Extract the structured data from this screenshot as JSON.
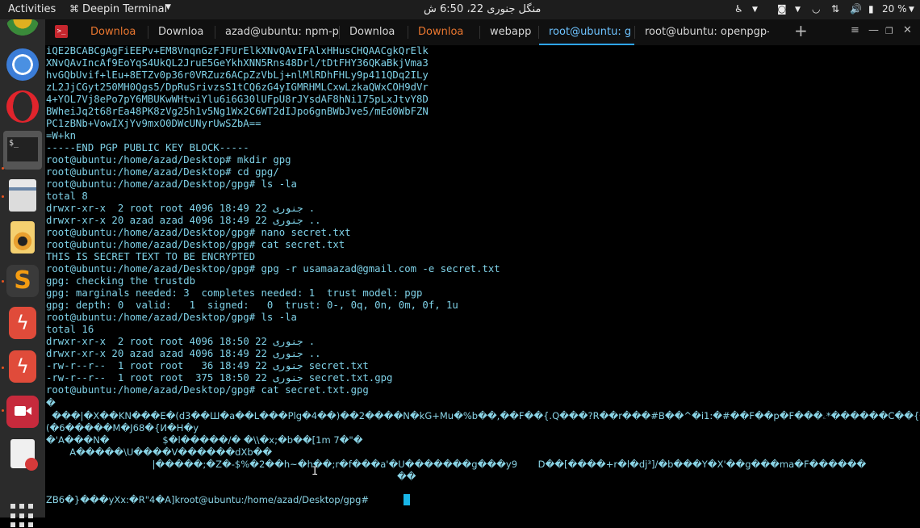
{
  "topbar": {
    "activities": "Activities",
    "app_name": "Deepin Terminal",
    "clock": "منگل جنوری 22، 6:50 ش",
    "battery": "20 %"
  },
  "dock": {
    "items": [
      "chrome-app",
      "chromium-app",
      "opera-app",
      "terminal-app",
      "files-app",
      "rhythmbox-app",
      "sublime-text-app",
      "filezilla-app",
      "filezilla-app-2",
      "screen-recorder-app",
      "text-editor-app"
    ]
  },
  "tabs": [
    {
      "label": "Downloa",
      "color": "#e9762f"
    },
    {
      "label": "Downloa",
      "color": "#d6d6d6"
    },
    {
      "label": "azad@ubuntu: npm-pro",
      "color": "#d6d6d6"
    },
    {
      "label": "Downloa",
      "color": "#d6d6d6"
    },
    {
      "label": "Downloa",
      "color": "#e9762f"
    },
    {
      "label": "webapp",
      "color": "#d6d6d6"
    },
    {
      "label": "root@ubuntu: g",
      "color": "#6ec3ff",
      "active": true
    },
    {
      "label": "root@ubuntu: openpgp-rev",
      "color": "#d6d6d6"
    }
  ],
  "terminal": {
    "lines": [
      "iQE2BCABCgAgFiEEPv+EM8VnqnGzFJFUrElkXNvQAvIFAlxHHusCHQAACgkQrElk",
      "XNvQAvIncAf9EoYqS4UkQL2JruE5GeYkhXNN5Rns48Drl/tDtFHY36QKaBkjVma3",
      "hvGQbUvif+lEu+8ETZv0p36r0VRZuz6ACpZzVbLj+nlMlRDhFHLy9p411QDq2ILy",
      "zL2JjCGyt250MH0Qgs5/DpRuSrivzsS1tCQ6zG4yIGMRHMLCxwLzkaQWxCOH9dVr",
      "4+YOL7Vj8ePo7pY6MBUKwWHtwiYlu6i6G30lUFpU8rJYsdAF8hNi175pLxJtvY8D",
      "BWheiJq2t68rEa48PK8zVg25h1v5Ng1Wx2C6WT2dIJpo6gnBWbJve5/mEd0WbFZN",
      "PC1zBNb+VowIXjYv9mxO0DWcUNyrUwSZbA==",
      "=W+kn",
      "-----END PGP PUBLIC KEY BLOCK-----",
      "root@ubuntu:/home/azad/Desktop# mkdir gpg",
      "root@ubuntu:/home/azad/Desktop# cd gpg/",
      "root@ubuntu:/home/azad/Desktop/gpg# ls -la",
      "total 8",
      "drwxr-xr-x  2 root root 4096 جنوری 22 18:49 .",
      "drwxr-xr-x 20 azad azad 4096 جنوری 22 18:49 ..",
      "root@ubuntu:/home/azad/Desktop/gpg# nano secret.txt",
      "root@ubuntu:/home/azad/Desktop/gpg# cat secret.txt",
      "THIS IS SECRET TEXT TO BE ENCRYPTED",
      "root@ubuntu:/home/azad/Desktop/gpg# gpg -r usamaazad@gmail.com -e secret.txt",
      "gpg: checking the trustdb",
      "gpg: marginals needed: 3  completes needed: 1  trust model: pgp",
      "gpg: depth: 0  valid:   1  signed:   0  trust: 0-, 0q, 0n, 0m, 0f, 1u",
      "root@ubuntu:/home/azad/Desktop/gpg# ls -la",
      "total 16",
      "drwxr-xr-x  2 root root 4096 جنوری 22 18:50 .",
      "drwxr-xr-x 20 azad azad 4096 جنوری 22 18:49 ..",
      "-rw-r--r--  1 root root   36 جنوری 22 18:49 secret.txt",
      "-rw-r--r--  1 root root  375 جنوری 22 18:50 secret.txt.gpg",
      "root@ubuntu:/home/azad/Desktop/gpg# cat secret.txt.gpg"
    ],
    "garbage": [
      "�",
      "  ���|�X��KN���E�(d3��Ш�a��L���Plg�4��)��2����N�kG+Mu�%b��,��F��{.Q���?R��r���#B��^�i1:�#��F��p�F���ۦ*������C��{���#�y��ө\\<K��U����Y�=�Ck�",
      "(�6�����M�J68�{И�H�y",
      "�'A���N�                  $�l�����/� �\\\\�x;�b��[1m 7�\"�",
      "        A�����\\U����V������dXb��",
      "                                    |�����;�Z�-$%�2��h~�h��;r�f���a'�U�������g���y9       D��[����+r�l�dj³]/�b���Y�X'��g���ma�F������",
      "                                                                                                                       ��",
      "",
      "ZB6�}���yXx:�R\"4�A]kroot@ubuntu:/home/azad/Desktop/gpg# "
    ]
  },
  "colors": {
    "terminal_text": "#7fd2e8",
    "active_tab": "#6ec3ff",
    "orange_tab": "#e9762f",
    "cursor": "#19b6e8"
  }
}
